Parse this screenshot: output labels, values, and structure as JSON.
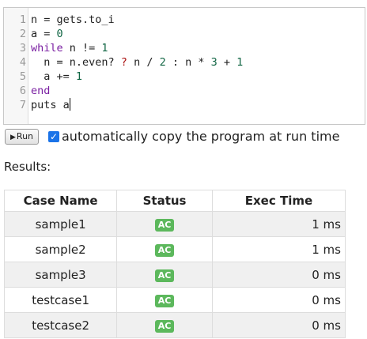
{
  "editor": {
    "lines": [
      {
        "no": "1",
        "tokens": [
          {
            "t": "n = gets.to_i",
            "c": "op"
          }
        ]
      },
      {
        "no": "2",
        "tokens": [
          {
            "t": "a = ",
            "c": "op"
          },
          {
            "t": "0",
            "c": "num"
          }
        ]
      },
      {
        "no": "3",
        "tokens": [
          {
            "t": "while",
            "c": "kw"
          },
          {
            "t": " n != ",
            "c": "op"
          },
          {
            "t": "1",
            "c": "num"
          }
        ]
      },
      {
        "no": "4",
        "tokens": [
          {
            "t": "  n = n.even? ",
            "c": "op"
          },
          {
            "t": "?",
            "c": "tern"
          },
          {
            "t": " n / ",
            "c": "op"
          },
          {
            "t": "2",
            "c": "num"
          },
          {
            "t": " : n * ",
            "c": "op"
          },
          {
            "t": "3",
            "c": "num"
          },
          {
            "t": " + ",
            "c": "op"
          },
          {
            "t": "1",
            "c": "num"
          }
        ]
      },
      {
        "no": "5",
        "tokens": [
          {
            "t": "  a += ",
            "c": "op"
          },
          {
            "t": "1",
            "c": "num"
          }
        ]
      },
      {
        "no": "6",
        "tokens": [
          {
            "t": "end",
            "c": "kw"
          }
        ]
      },
      {
        "no": "7",
        "tokens": [
          {
            "t": "puts a",
            "c": "op"
          }
        ]
      }
    ]
  },
  "toolbar": {
    "run_label": "Run",
    "run_icon": "play-triangle-icon",
    "auto_copy_checked": true,
    "auto_copy_label": "automatically copy the program at run time"
  },
  "results": {
    "label": "Results:",
    "headers": [
      "Case Name",
      "Status",
      "Exec Time"
    ],
    "rows": [
      {
        "name": "sample1",
        "status": "AC",
        "time": "1 ms"
      },
      {
        "name": "sample2",
        "status": "AC",
        "time": "1 ms"
      },
      {
        "name": "sample3",
        "status": "AC",
        "time": "0 ms"
      },
      {
        "name": "testcase1",
        "status": "AC",
        "time": "0 ms"
      },
      {
        "name": "testcase2",
        "status": "AC",
        "time": "0 ms"
      }
    ],
    "status_color": "#5cb85c"
  }
}
